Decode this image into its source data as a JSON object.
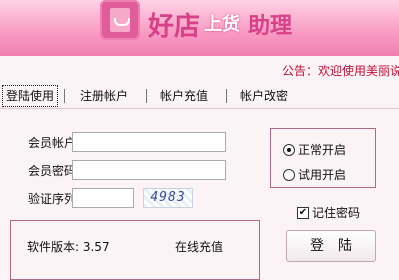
{
  "header": {
    "logo_icon": "shopping-bag-icon",
    "title_part1": "好店",
    "title_part2": "上货",
    "title_part3": "助理",
    "notice": "公告：欢迎使用美丽说"
  },
  "tabs": [
    {
      "label": "登陆使用",
      "active": true
    },
    {
      "label": "注册帐户",
      "active": false
    },
    {
      "label": "帐户充值",
      "active": false
    },
    {
      "label": "帐户改密",
      "active": false
    }
  ],
  "form": {
    "account_label": "会员帐户:",
    "account_value": "",
    "password_label": "会员密码:",
    "password_value": "",
    "captcha_label": "验证序列:",
    "captcha_value": "",
    "captcha_code": "4983"
  },
  "mode": {
    "normal_label": "正常开启",
    "trial_label": "试用开启",
    "selected": "normal"
  },
  "remember_label": "记住密码",
  "remember_checked": true,
  "info": {
    "version_label": "软件版本: 3.57",
    "recharge_link": "在线充值"
  },
  "login_button": "登陆",
  "colors": {
    "banner_pink": "#f07fb1",
    "notice_red": "#c0123a",
    "panel_border": "#b0698a"
  }
}
